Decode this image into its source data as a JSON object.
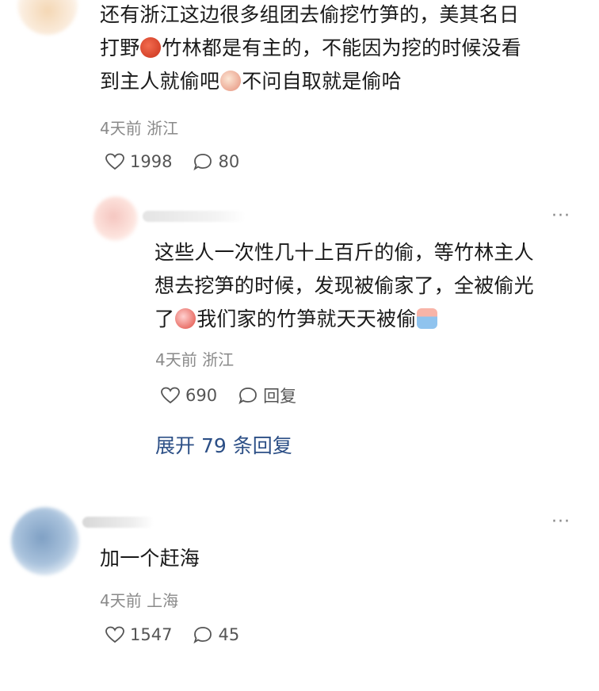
{
  "comments": [
    {
      "lines": [
        "还有浙江这边很多组团去偷挖竹笋的，美其名日",
        "打野{e}竹林都是有主的，不能因为挖的时候没看",
        "到主人就偷吧{e}不问自取就是偷哈"
      ],
      "text_parts": [
        [
          "还有浙江这边很多组团去偷挖竹笋的，美其名日"
        ],
        [
          "打野",
          "竹林都是有主的，不能因为挖的时候没看"
        ],
        [
          "到主人就偷吧",
          "不问自取就是偷哈"
        ]
      ],
      "emojis": [
        "angry-face-emoji",
        "grimace-face-emoji"
      ],
      "time": "4天前",
      "location": "浙江",
      "likes": "1998",
      "replies": "80"
    },
    {
      "text_parts": [
        [
          "这些人一次性几十上百斤的偷，等竹林主人"
        ],
        [
          "想去挖笋的时候，发现被偷家了，全被偷光"
        ],
        [
          "了",
          "我们家的竹笋就天天被偷"
        ]
      ],
      "emojis": [
        "shocked-face-emoji",
        "crying-face-emoji"
      ],
      "time": "4天前",
      "location": "浙江",
      "likes": "690",
      "reply_label": "回复",
      "expand_label": "展开 79 条回复"
    },
    {
      "text_parts": [
        [
          "加一个赶海"
        ]
      ],
      "time": "4天前",
      "location": "上海",
      "likes": "1547",
      "replies": "45"
    }
  ],
  "more_glyph": "···",
  "colors": {
    "text": "#1a1a1a",
    "meta": "#8a8a8a",
    "link": "#2c4f86"
  },
  "icons": [
    "heart-icon",
    "comment-bubble-icon",
    "more-icon"
  ]
}
